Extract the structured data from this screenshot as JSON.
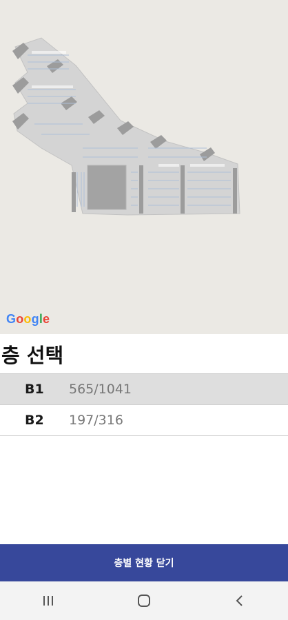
{
  "map": {
    "attribution": [
      "G",
      "o",
      "o",
      "g",
      "l",
      "e"
    ],
    "icons": {
      "attribution": "google-logo"
    }
  },
  "floor_panel": {
    "title": "층 선택",
    "floors": [
      {
        "name": "B1",
        "count": "565/1041",
        "selected": true
      },
      {
        "name": "B2",
        "count": "197/316",
        "selected": false
      }
    ]
  },
  "close_button": {
    "label": "층별 현황 닫기"
  },
  "nav": {
    "icons": [
      "recent-apps-icon",
      "home-icon",
      "back-icon"
    ]
  },
  "colors": {
    "map_bg": "#ebe9e4",
    "building": "#d6d6d6",
    "accent": "#37489b",
    "selected_row": "#dedede"
  }
}
